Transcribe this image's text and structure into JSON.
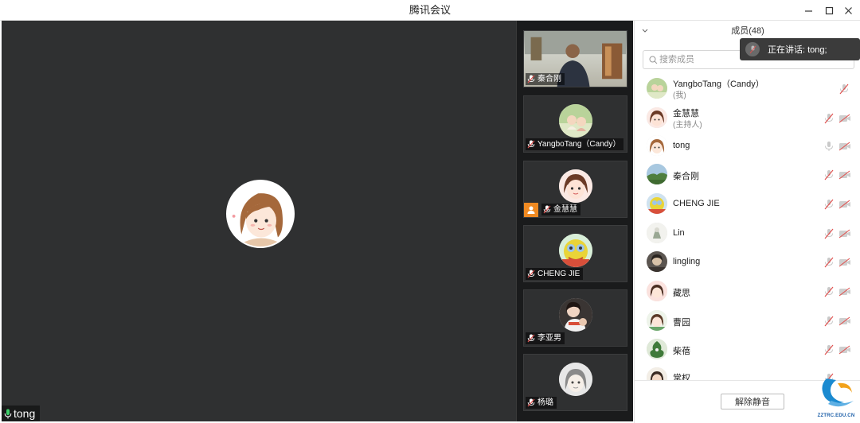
{
  "window": {
    "title": "腾讯会议",
    "controls": [
      "minimize-icon",
      "maximize-icon",
      "close-icon"
    ]
  },
  "stage": {
    "active_speaker_name": "tong",
    "mic_icon": "mic-icon"
  },
  "thumbnails": [
    {
      "name": "秦合刚",
      "type": "video"
    },
    {
      "name": "YangboTang（Candy）",
      "type": "avatar"
    },
    {
      "name": "金慧慧",
      "type": "avatar",
      "host": true
    },
    {
      "name": "CHENG JIE",
      "type": "avatar"
    },
    {
      "name": "李亚男",
      "type": "avatar"
    },
    {
      "name": "杨璐",
      "type": "avatar"
    }
  ],
  "panel": {
    "title": "成员(48)",
    "search_placeholder": "搜索成员",
    "members": [
      {
        "name": "YangboTang（Candy）",
        "role": "(我)",
        "mic": "muted",
        "camera": "hidden"
      },
      {
        "name": "金慧慧",
        "role": "(主持人)",
        "mic": "muted",
        "camera": "off"
      },
      {
        "name": "tong",
        "role": "",
        "mic": "active",
        "camera": "off"
      },
      {
        "name": "秦合刚",
        "role": "",
        "mic": "muted",
        "camera": "off"
      },
      {
        "name": "CHENG JIE",
        "role": "",
        "mic": "muted",
        "camera": "off"
      },
      {
        "name": "Lin",
        "role": "",
        "mic": "muted",
        "camera": "off"
      },
      {
        "name": "lingling",
        "role": "",
        "mic": "muted",
        "camera": "off"
      },
      {
        "name": "藏思",
        "role": "",
        "mic": "muted",
        "camera": "off"
      },
      {
        "name": "曹园",
        "role": "",
        "mic": "muted",
        "camera": "off"
      },
      {
        "name": "柴蓓",
        "role": "",
        "mic": "muted",
        "camera": "off"
      },
      {
        "name": "常权",
        "role": "",
        "mic": "muted",
        "camera": "off"
      }
    ],
    "footer_button": "解除静音"
  },
  "toast": {
    "text": "正在讲话: tong;"
  },
  "watermark": {
    "text": "ZZTRC.EDU.CN"
  },
  "colors": {
    "stage_bg": "#2f3031",
    "strip_bg": "#1a1b1c",
    "muted_red": "#e0514f",
    "host_orange": "#f08a22"
  }
}
